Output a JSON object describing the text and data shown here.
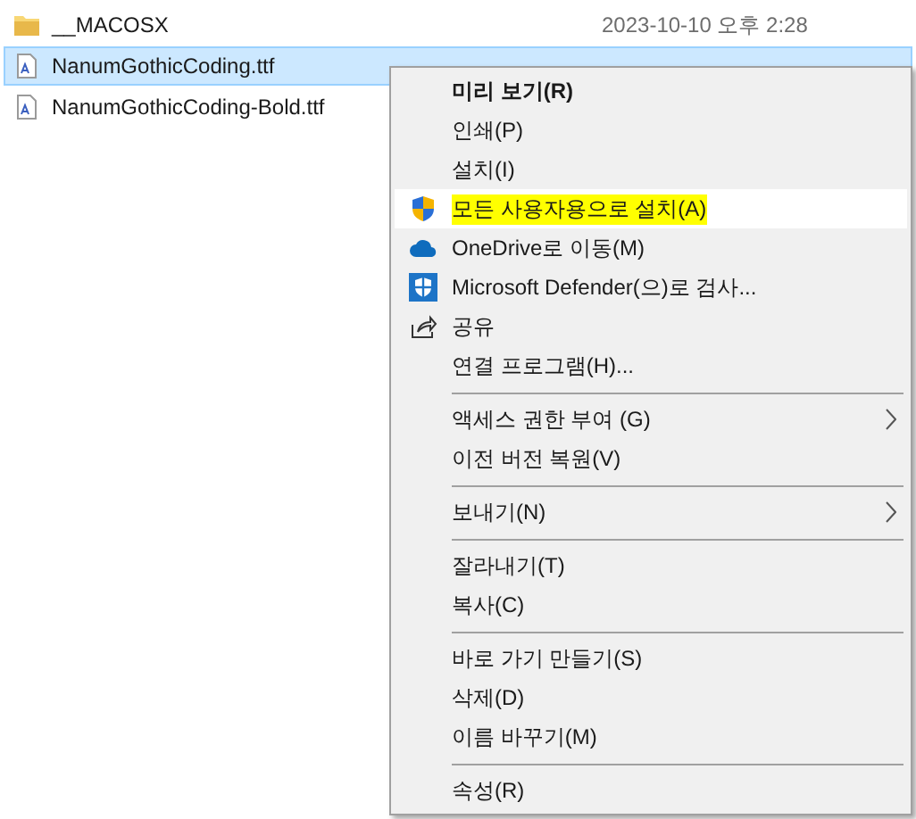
{
  "files": [
    {
      "name": "__MACOSX",
      "date": "2023-10-10 오후 2:28",
      "kind": "folder",
      "selected": false
    },
    {
      "name": "NanumGothicCoding.ttf",
      "kind": "font",
      "selected": true
    },
    {
      "name": "NanumGothicCoding-Bold.ttf",
      "kind": "font",
      "selected": false
    }
  ],
  "context_menu": {
    "items": [
      {
        "kind": "item",
        "label": "미리 보기(R)",
        "default": true
      },
      {
        "kind": "item",
        "label": "인쇄(P)"
      },
      {
        "kind": "item",
        "label": "설치(I)"
      },
      {
        "kind": "shield",
        "label": "모든 사용자용으로 설치(A)",
        "hovered": true,
        "marked": true
      },
      {
        "kind": "cloud",
        "label": "OneDrive로 이동(M)"
      },
      {
        "kind": "defender",
        "label": "Microsoft Defender(으)로 검사..."
      },
      {
        "kind": "share",
        "label": "공유"
      },
      {
        "kind": "item",
        "label": "연결 프로그램(H)..."
      },
      {
        "kind": "separator"
      },
      {
        "kind": "item",
        "label": "액세스 권한 부여 (G)",
        "submenu": true
      },
      {
        "kind": "item",
        "label": "이전 버전 복원(V)"
      },
      {
        "kind": "separator"
      },
      {
        "kind": "item",
        "label": "보내기(N)",
        "submenu": true
      },
      {
        "kind": "separator"
      },
      {
        "kind": "item",
        "label": "잘라내기(T)"
      },
      {
        "kind": "item",
        "label": "복사(C)"
      },
      {
        "kind": "separator"
      },
      {
        "kind": "item",
        "label": "바로 가기 만들기(S)"
      },
      {
        "kind": "item",
        "label": "삭제(D)"
      },
      {
        "kind": "item",
        "label": "이름 바꾸기(M)"
      },
      {
        "kind": "separator"
      },
      {
        "kind": "item",
        "label": "속성(R)"
      }
    ]
  }
}
